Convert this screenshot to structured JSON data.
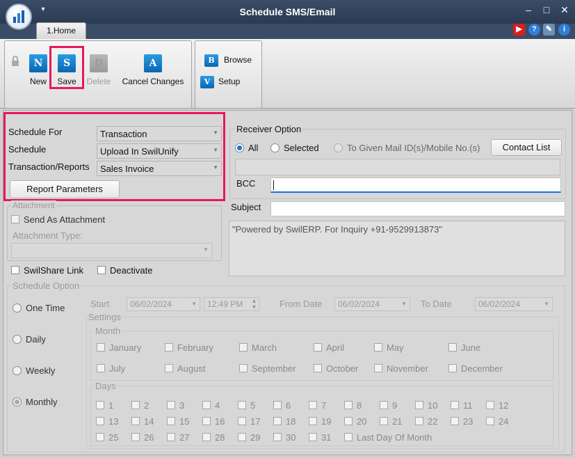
{
  "window": {
    "title": "Schedule SMS/Email",
    "tab": "1.Home"
  },
  "ribbon": {
    "new_label": "New",
    "save_label": "Save",
    "delete_label": "Delete",
    "cancel_label": "Cancel Changes",
    "browse_label": "Browse",
    "setup_label": "Setup",
    "icons": {
      "new": "N",
      "save": "S",
      "delete": "D",
      "cancel": "A",
      "browse": "B",
      "setup": "V"
    }
  },
  "schedule": {
    "schedule_for_label": "Schedule For",
    "schedule_for_value": "Transaction",
    "schedule_label": "Schedule",
    "schedule_value": "Upload In SwilUnify",
    "trans_label": "Transaction/Reports",
    "trans_value": "Sales Invoice",
    "report_params_label": "Report Parameters"
  },
  "attachment": {
    "group_label": "Attachment",
    "send_as_label": "Send As Attachment",
    "type_label": "Attachment Type:",
    "type_value": ""
  },
  "options": {
    "swilshare_label": "SwilShare Link",
    "deactivate_label": "Deactivate"
  },
  "receiver": {
    "group_label": "Receiver Option",
    "all_label": "All",
    "selected_label": "Selected",
    "given_label": "To Given Mail ID(s)/Mobile No.(s)",
    "contact_list_label": "Contact List",
    "bcc_label": "BCC",
    "subject_label": "Subject",
    "message": "\"Powered by SwilERP. For Inquiry  +91-9529913873\""
  },
  "schedule_option": {
    "group_label": "Schedule Option",
    "one_time_label": "One Time",
    "daily_label": "Daily",
    "weekly_label": "Weekly",
    "monthly_label": "Monthly",
    "start_label": "Start",
    "start_date": "06/02/2024",
    "start_time": "12:49 PM",
    "from_label": "From Date",
    "from_date": "06/02/2024",
    "to_label": "To Date",
    "to_date": "06/02/2024",
    "settings_label": "Settings",
    "month_label": "Month",
    "days_label": "Days",
    "months": [
      "January",
      "February",
      "March",
      "April",
      "May",
      "June",
      "July",
      "August",
      "September",
      "October",
      "November",
      "December"
    ],
    "days": [
      "1",
      "2",
      "3",
      "4",
      "5",
      "6",
      "7",
      "8",
      "9",
      "10",
      "11",
      "12",
      "13",
      "14",
      "15",
      "16",
      "17",
      "18",
      "19",
      "20",
      "21",
      "22",
      "23",
      "24",
      "25",
      "26",
      "27",
      "28",
      "29",
      "30",
      "31"
    ],
    "last_day_label": "Last Day Of Month"
  },
  "colors": {
    "highlight": "#e8175d",
    "titlebar": "#2a3a52",
    "accent": "#1a73d8"
  }
}
